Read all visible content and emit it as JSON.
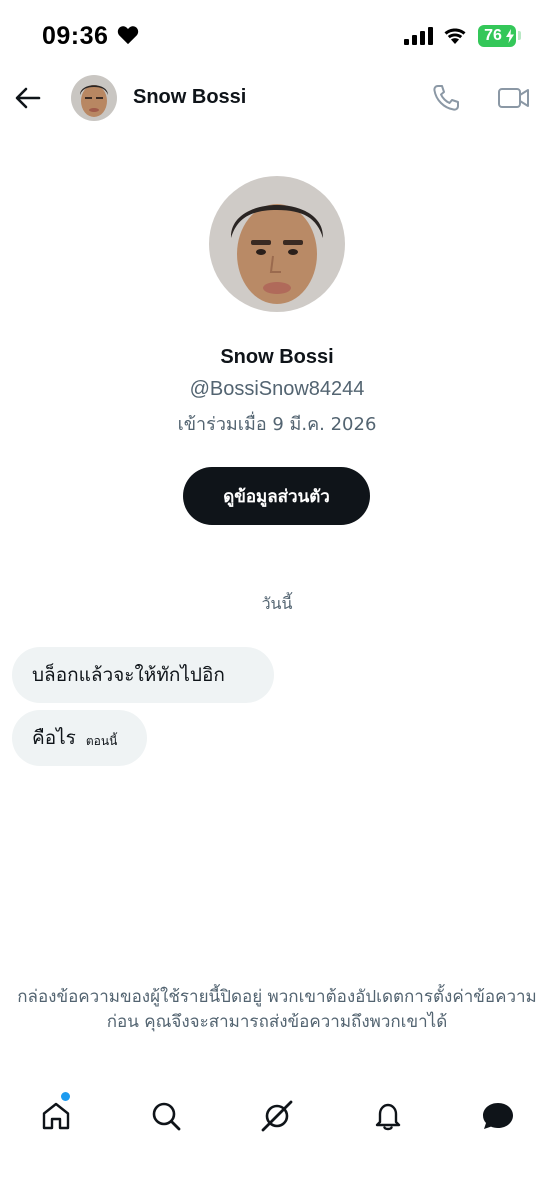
{
  "status_bar": {
    "time": "09:36",
    "battery": "76",
    "icons": [
      "heart-icon",
      "cellular-signal-icon",
      "wifi-icon",
      "battery-charging-icon"
    ],
    "battery_color": "#34c759"
  },
  "header": {
    "name": "Snow Bossi",
    "icons": [
      "back-arrow-icon",
      "phone-icon",
      "video-camera-icon"
    ]
  },
  "profile": {
    "name": "Snow Bossi",
    "handle": "@BossiSnow84244",
    "joined": "เข้าร่วมเมื่อ 9 มี.ค. 2026",
    "view_profile_button": "ดูข้อมูลส่วนตัว"
  },
  "conversation": {
    "date_separator": "วันนี้",
    "messages": [
      {
        "text": "บล็อกแล้วจะให้ทักไปอิก",
        "time": ""
      },
      {
        "text": "คือไร",
        "time": "ตอนนี้"
      }
    ]
  },
  "notice": {
    "text": "กล่องข้อความของผู้ใช้รายนี้ปิดอยู่ พวกเขาต้องอัปเดตการตั้งค่าข้อความก่อน คุณจึงจะสามารถส่งข้อความถึงพวกเขาได้"
  },
  "bottom_nav": {
    "items": [
      "home-icon",
      "search-icon",
      "grok-icon",
      "notifications-bell-icon",
      "messages-icon"
    ],
    "active": "messages-icon",
    "notification_dot_color": "#1d9bf0"
  },
  "colors": {
    "text_primary": "#0f1419",
    "text_secondary": "#536471",
    "bubble_bg": "#eff3f4",
    "button_bg": "#0f1419"
  }
}
